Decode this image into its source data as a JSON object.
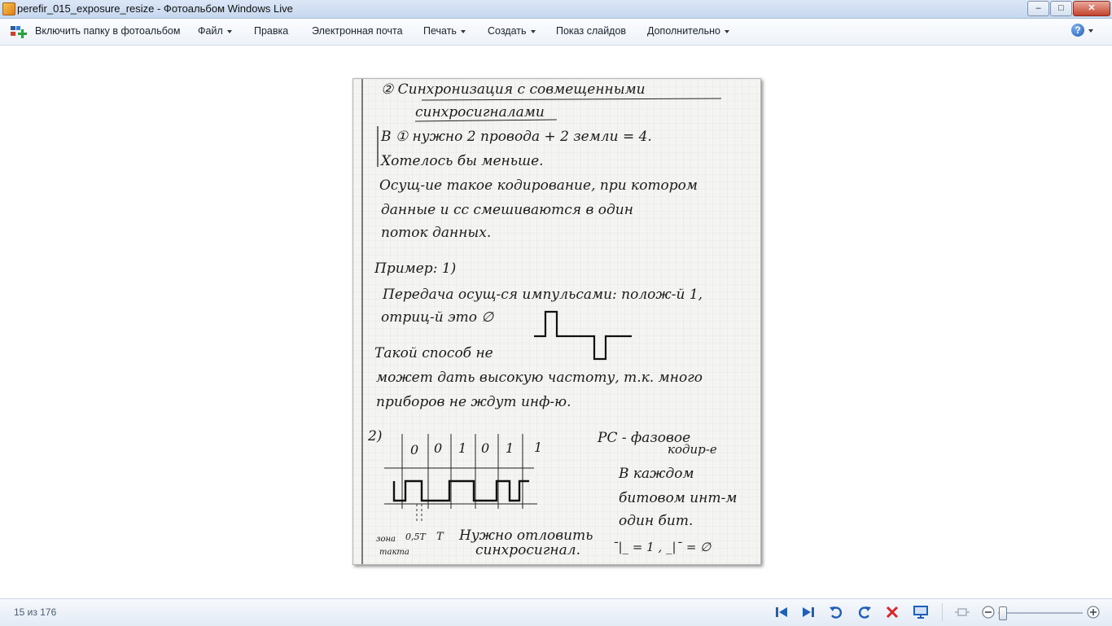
{
  "window": {
    "title": "perefir_015_exposure_resize - Фотоальбом Windows Live",
    "minimize_label": "–",
    "maximize_label": "□",
    "close_label": "✕"
  },
  "menu": {
    "include_folder": "Включить папку в фотоальбом",
    "file": "Файл",
    "edit": "Правка",
    "email": "Электронная почта",
    "print": "Печать",
    "create": "Создать",
    "slideshow": "Показ слайдов",
    "extra": "Дополнительно",
    "help_glyph": "?"
  },
  "photo": {
    "lines": [
      "②  Синхронизация с совмещенными",
      "синхросигналами",
      "В ① нужно 2 провода + 2 земли = 4.",
      "Хотелось бы меньше.",
      "Осущ-ие такое кодирование, при котором",
      "данные и сс смешиваются в один",
      "поток данных.",
      "Пример: 1)",
      "Передача осущ-ся импульсами: полож-й 1,",
      "отриц-й это ∅",
      "Такой способ не",
      "может дать высокую частоту, т.к. много",
      "приборов не ждут инф-ю.",
      "2)",
      "PC - фазовое",
      "кодир-е",
      "В каждом",
      "битовом инт-м",
      "один бит.",
      "Нужно отловить",
      "синхросигнал.",
      "зона",
      "такта",
      "0,5T",
      "T",
      "¯|_ = 1 ,  _|¯ = ∅"
    ],
    "bits": [
      "0",
      "0",
      "1",
      "0",
      "1",
      "1"
    ]
  },
  "status": {
    "counter": "15 из 176"
  },
  "icons": {
    "first": "first-photo-icon",
    "next": "next-photo-icon",
    "rotate_left": "rotate-left-icon",
    "rotate_right": "rotate-right-icon",
    "delete": "delete-icon",
    "slideshow": "slideshow-icon",
    "fit": "fit-window-icon",
    "zoom_out": "zoom-out-icon",
    "zoom_in": "zoom-in-icon"
  },
  "colors": {
    "nav_blue": "#1f5fb8",
    "delete_red": "#d8262b"
  }
}
